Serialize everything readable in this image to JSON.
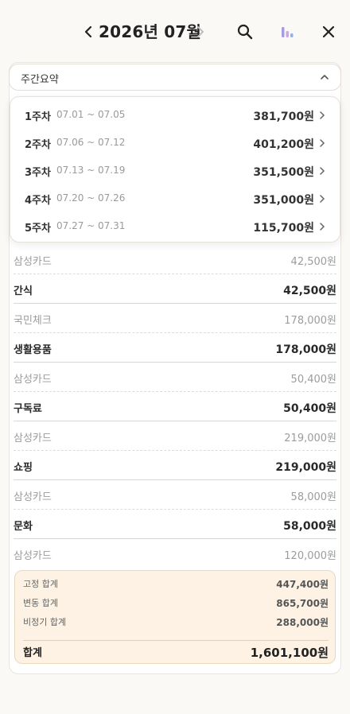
{
  "header": {
    "title": "2026년 07월",
    "prev_icon": "chevron-left-icon",
    "next_icon": "chevron-right-icon",
    "search_icon": "search-icon",
    "chart_icon": "bar-chart-icon",
    "close_icon": "close-icon"
  },
  "summary_toggle": {
    "label": "주간요약",
    "icon": "chevron-up-icon"
  },
  "weekly": [
    {
      "name": "1주차",
      "range": "07.01 ~ 07.05",
      "amount": "381,700원"
    },
    {
      "name": "2주차",
      "range": "07.06 ~ 07.12",
      "amount": "401,200원"
    },
    {
      "name": "3주차",
      "range": "07.13 ~ 07.19",
      "amount": "351,500원"
    },
    {
      "name": "4주차",
      "range": "07.20 ~ 07.26",
      "amount": "351,000원"
    },
    {
      "name": "5주차",
      "range": "07.27 ~ 07.31",
      "amount": "115,700원"
    }
  ],
  "rows": [
    {
      "kind": "sub",
      "name": "삼성카드",
      "amount": "42,500원"
    },
    {
      "kind": "cat",
      "name": "간식",
      "amount": "42,500원"
    },
    {
      "kind": "sub",
      "name": "국민체크",
      "amount": "178,000원"
    },
    {
      "kind": "cat",
      "name": "생활용품",
      "amount": "178,000원"
    },
    {
      "kind": "sub",
      "name": "삼성카드",
      "amount": "50,400원"
    },
    {
      "kind": "cat",
      "name": "구독료",
      "amount": "50,400원"
    },
    {
      "kind": "sub",
      "name": "삼성카드",
      "amount": "219,000원"
    },
    {
      "kind": "cat",
      "name": "쇼핑",
      "amount": "219,000원"
    },
    {
      "kind": "sub",
      "name": "삼성카드",
      "amount": "58,000원"
    },
    {
      "kind": "cat",
      "name": "문화",
      "amount": "58,000원"
    },
    {
      "kind": "sub",
      "name": "삼성카드",
      "amount": "120,000원"
    }
  ],
  "totals": {
    "fixed": {
      "label": "고정 합계",
      "amount": "447,400원"
    },
    "variable": {
      "label": "변동 합계",
      "amount": "865,700원"
    },
    "irregular": {
      "label": "비정기 합계",
      "amount": "288,000원"
    },
    "total": {
      "label": "합계",
      "amount": "1,601,100원"
    }
  },
  "colors": {
    "accent_chart": "#9b8cd6",
    "summary_bg": "#fdf2e3"
  }
}
